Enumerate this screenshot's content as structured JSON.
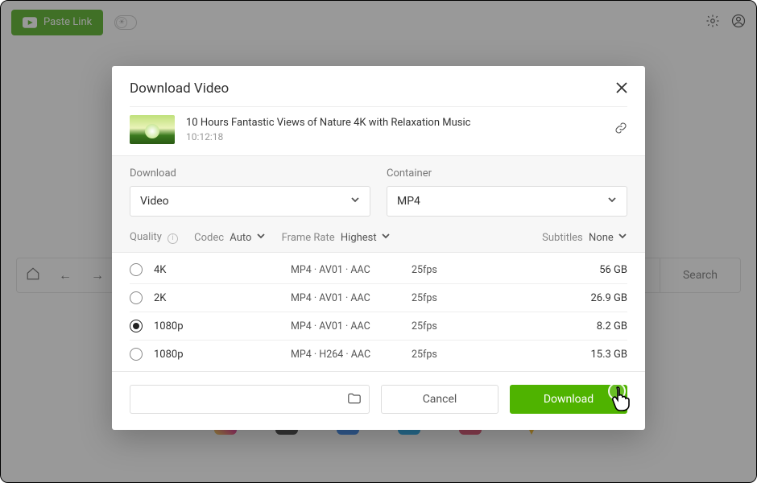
{
  "topbar": {
    "paste_label": "Paste Link"
  },
  "nav": {
    "search_label": "Search"
  },
  "modal": {
    "title": "Download Video",
    "video": {
      "title": "10 Hours Fantastic Views of Nature 4K with Relaxation Music",
      "duration": "10:12:18"
    },
    "download_label": "Download",
    "container_label": "Container",
    "download_select_value": "Video",
    "container_select_value": "MP4",
    "filters": {
      "quality_label": "Quality",
      "codec_label": "Codec",
      "codec_value": "Auto",
      "framerate_label": "Frame Rate",
      "framerate_value": "Highest",
      "subtitles_label": "Subtitles",
      "subtitles_value": "None"
    },
    "options": [
      {
        "name": "4K",
        "codec": "MP4 · AV01 · AAC",
        "fps": "25fps",
        "size": "56 GB",
        "selected": false
      },
      {
        "name": "2K",
        "codec": "MP4 · AV01 · AAC",
        "fps": "25fps",
        "size": "26.9 GB",
        "selected": false
      },
      {
        "name": "1080p",
        "codec": "MP4 · AV01 · AAC",
        "fps": "25fps",
        "size": "8.2 GB",
        "selected": true
      },
      {
        "name": "1080p",
        "codec": "MP4 · H264 · AAC",
        "fps": "25fps",
        "size": "15.3 GB",
        "selected": false
      }
    ],
    "footer": {
      "cancel": "Cancel",
      "download": "Download"
    }
  }
}
